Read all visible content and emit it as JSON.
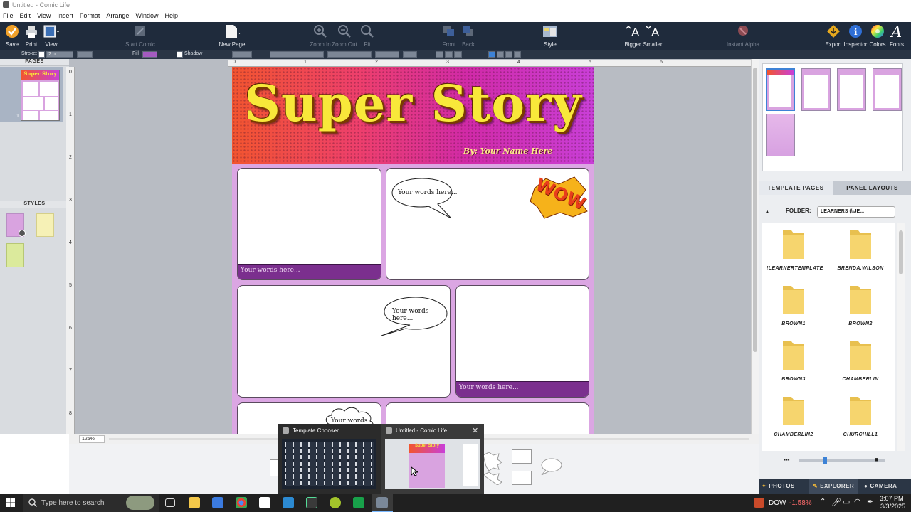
{
  "window": {
    "title": "Untitled - Comic Life"
  },
  "menu": [
    "File",
    "Edit",
    "View",
    "Insert",
    "Format",
    "Arrange",
    "Window",
    "Help"
  ],
  "toolbar": {
    "save": "Save",
    "print": "Print",
    "view": "View",
    "start_comic": "Start Comic",
    "new_page": "New Page",
    "zoom_in": "Zoom In",
    "zoom_out": "Zoom Out",
    "fit": "Fit",
    "front": "Front",
    "back": "Back",
    "style": "Style",
    "bigger": "Bigger",
    "smaller": "Smaller",
    "instant_alpha": "Instant Alpha",
    "export": "Export",
    "inspector": "Inspector",
    "colors": "Colors",
    "fonts": "Fonts"
  },
  "options_bar": {
    "stroke_label": "Stroke:",
    "stroke_value": "2 pt",
    "fill_label": "Fill",
    "shadow_label": "Shadow",
    "fill_color": "#a45bc0"
  },
  "pages_panel": {
    "header": "PAGES",
    "page_number": "1"
  },
  "styles_panel": {
    "header": "STYLES"
  },
  "comic": {
    "title": "Super Story",
    "byline": "By: Your Name Here",
    "caption_text": "Your words here...",
    "bubble_text": "Your words here...",
    "wow_text": "WOW"
  },
  "zoom": {
    "value": "125%"
  },
  "ruler_top": [
    "0",
    "1",
    "2",
    "3",
    "4",
    "5",
    "6"
  ],
  "ruler_left": [
    "0",
    "1",
    "2",
    "3",
    "4",
    "5",
    "6",
    "7",
    "8"
  ],
  "right_panel": {
    "tab_template_pages": "TEMPLATE PAGES",
    "tab_panel_layouts": "PANEL LAYOUTS",
    "folder_label": "FOLDER:",
    "folder_value": "LEARNERS (\\\\JE...",
    "folders": [
      "!LEARNERTEMPLATE",
      "BRENDA.WILSON",
      "BROWN1",
      "BROWN2",
      "BROWN3",
      "CHAMBERLIN",
      "CHAMBERLIN2",
      "CHURCHILL1"
    ],
    "bottom_tabs": [
      "PHOTOS",
      "EXPLORER",
      "CAMERA"
    ]
  },
  "taskbar_popup": {
    "item1": "Template Chooser",
    "item2": "Untitled - Comic Life"
  },
  "taskbar": {
    "search_placeholder": "Type here to search",
    "ticker_name": "DOW",
    "ticker_change": "-1.58%",
    "time": "3:07 PM",
    "date": "3/3/2025"
  },
  "colors": {
    "toolbar_bg": "#1f2b3c",
    "page_bg": "#dba6e3",
    "caption_bg": "#7b2f8e",
    "title_yellow": "#f8e83a",
    "ticker_red": "#ff6b6b"
  }
}
